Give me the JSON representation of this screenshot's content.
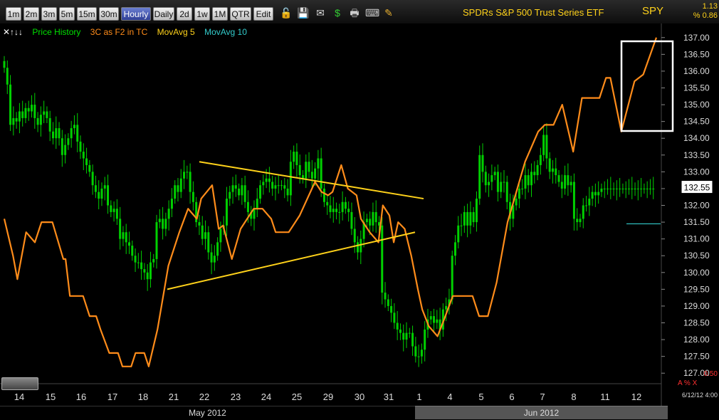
{
  "toolbar": {
    "timeframes": [
      "1m",
      "2m",
      "3m",
      "5m",
      "15m",
      "30m",
      "Hourly",
      "Daily",
      "2d",
      "1w",
      "1M",
      "QTR",
      "Edit"
    ],
    "active": "Hourly",
    "icons": [
      "lock-icon",
      "save-icon",
      "email-icon",
      "dollar-icon",
      "print-icon",
      "keyboard-icon",
      "pencil-icon"
    ]
  },
  "header": {
    "title": "SPDRs S&P 500 Trust Series ETF",
    "ticker": "SPY",
    "change": "1.13",
    "change_pct": "% 0.86"
  },
  "legend": {
    "controls": "✕↑↓↓",
    "items": [
      {
        "label": "Price History",
        "color": "#00e000"
      },
      {
        "label": "3C as F2 in TC",
        "color": "#ff8c1a"
      },
      {
        "label": "MovAvg 5",
        "color": "#ffd21a"
      },
      {
        "label": "MovAvg 10",
        "color": "#33cccc"
      }
    ]
  },
  "footer": {
    "date": "6/12/12 4:00",
    "bottom_value": "0.50",
    "alert_label": "A  %  X",
    "months": [
      {
        "label": "May 2012"
      },
      {
        "label": "Jun 2012"
      }
    ]
  },
  "chart_data": {
    "type": "line",
    "title": "SPDRs S&P 500 Trust Series ETF",
    "ylim": [
      126.75,
      137.25
    ],
    "yticks": [
      "137.00",
      "136.50",
      "136.00",
      "135.50",
      "135.00",
      "134.50",
      "134.00",
      "133.50",
      "133.00",
      "132.50",
      "132.00",
      "131.50",
      "131.00",
      "130.50",
      "130.00",
      "129.50",
      "129.00",
      "128.50",
      "128.00",
      "127.50",
      "127.00"
    ],
    "x_labels": [
      "14",
      "15",
      "16",
      "17",
      "18",
      "21",
      "22",
      "23",
      "24",
      "25",
      "29",
      "30",
      "31",
      "1",
      "4",
      "5",
      "6",
      "7",
      "8",
      "11",
      "12"
    ],
    "last_price": "132.55",
    "price_history": {
      "name": "Price History",
      "type": "candlestick",
      "bar_count": 215,
      "close": [
        136.1,
        135.6,
        134.4,
        134.6,
        134.5,
        134.8,
        134.6,
        134.9,
        134.8,
        135.0,
        134.6,
        134.4,
        134.7,
        134.8,
        134.6,
        134.2,
        134.0,
        134.3,
        134.0,
        133.5,
        133.8,
        134.0,
        134.3,
        134.4,
        133.9,
        133.6,
        133.4,
        133.2,
        133.0,
        132.6,
        132.4,
        132.2,
        132.5,
        132.6,
        132.0,
        131.8,
        131.9,
        131.6,
        131.0,
        131.2,
        130.9,
        130.8,
        130.5,
        130.3,
        130.3,
        130.1,
        130.0,
        129.8,
        130.3,
        130.4,
        131.5,
        131.6,
        131.3,
        131.6,
        131.9,
        132.2,
        132.6,
        132.4,
        132.8,
        133.0,
        133.0,
        132.4,
        132.1,
        131.5,
        131.4,
        131.0,
        131.2,
        130.6,
        130.3,
        130.5,
        130.9,
        131.3,
        131.4,
        132.2,
        132.4,
        132.6,
        132.5,
        132.3,
        132.6,
        132.1,
        131.8,
        131.6,
        131.9,
        132.2,
        132.6,
        132.7,
        132.8,
        132.7,
        132.5,
        132.6,
        132.6,
        132.6,
        132.5,
        132.3,
        133.3,
        133.6,
        133.2,
        132.9,
        132.8,
        133.3,
        133.0,
        132.8,
        133.1,
        133.4,
        132.5,
        132.1,
        132.0,
        131.8,
        131.9,
        131.8,
        131.8,
        132.1,
        131.9,
        131.8,
        131.3,
        130.9,
        130.6,
        131.0,
        131.5,
        131.6,
        131.4,
        131.8,
        131.5,
        131.4,
        129.4,
        129.2,
        129.0,
        128.8,
        128.5,
        128.3,
        128.2,
        128.0,
        128.2,
        128.2,
        127.8,
        127.5,
        127.5,
        127.7,
        128.3,
        128.6,
        128.7,
        128.5,
        128.6,
        128.3,
        128.9,
        129.0,
        129.2,
        130.5,
        130.9,
        131.4,
        131.4,
        131.8,
        131.4,
        131.8,
        131.5,
        132.2,
        133.5,
        133.0,
        132.6,
        132.7,
        132.9,
        133.0,
        132.4,
        132.7,
        132.7,
        132.1,
        131.6,
        132.0,
        132.2,
        132.5,
        132.5,
        132.9,
        132.6,
        133.0,
        132.9,
        133.2,
        133.5,
        134.1,
        133.4,
        133.0,
        133.1,
        132.9,
        132.7,
        132.5,
        132.9,
        132.6,
        132.7,
        131.6,
        131.5,
        131.6,
        132.0,
        132.0,
        132.2,
        132.4,
        132.3,
        132.4,
        132.5,
        132.5,
        132.5,
        132.5,
        132.5,
        132.5,
        132.5,
        132.5,
        132.5,
        132.5,
        132.5,
        132.5,
        132.5,
        132.5,
        132.5,
        132.5,
        132.5,
        132.5
      ]
    },
    "series": [
      {
        "name": "3C as F2 in TC",
        "color": "#ff8c1a",
        "points": [
          [
            0,
            131.6
          ],
          [
            4,
            130.5
          ],
          [
            6,
            129.8
          ],
          [
            10,
            131.2
          ],
          [
            14,
            130.9
          ],
          [
            17,
            131.5
          ],
          [
            22,
            131.5
          ],
          [
            27,
            130.4
          ],
          [
            28,
            130.4
          ],
          [
            30,
            129.3
          ],
          [
            36,
            129.3
          ],
          [
            39,
            128.7
          ],
          [
            42,
            128.7
          ],
          [
            44,
            128.3
          ],
          [
            48,
            127.6
          ],
          [
            52,
            127.6
          ],
          [
            54,
            127.2
          ],
          [
            58,
            127.2
          ],
          [
            60,
            127.6
          ],
          [
            64,
            127.6
          ],
          [
            66,
            127.2
          ],
          [
            70,
            128.3
          ],
          [
            75,
            130.2
          ],
          [
            80,
            131.2
          ],
          [
            84,
            131.9
          ],
          [
            88,
            131.6
          ],
          [
            90,
            132.2
          ],
          [
            95,
            132.6
          ],
          [
            98,
            131.3
          ],
          [
            100,
            131.4
          ],
          [
            104,
            130.4
          ],
          [
            108,
            131.3
          ],
          [
            114,
            131.9
          ],
          [
            118,
            131.9
          ],
          [
            122,
            131.6
          ],
          [
            124,
            131.2
          ],
          [
            130,
            131.2
          ],
          [
            135,
            131.7
          ],
          [
            142,
            132.7
          ],
          [
            145,
            132.4
          ],
          [
            148,
            132.3
          ],
          [
            150,
            132.4
          ],
          [
            154,
            133.2
          ],
          [
            157,
            132.5
          ],
          [
            161,
            132.3
          ],
          [
            163,
            131.6
          ],
          [
            167,
            131.2
          ],
          [
            171,
            130.9
          ],
          [
            173,
            132.0
          ],
          [
            176,
            131.7
          ],
          [
            178,
            130.9
          ],
          [
            180,
            131.5
          ],
          [
            183,
            131.3
          ],
          [
            186,
            130.5
          ],
          [
            189,
            129.5
          ],
          [
            191,
            128.9
          ],
          [
            194,
            128.4
          ],
          [
            198,
            128.1
          ],
          [
            201,
            128.6
          ],
          [
            205,
            129.3
          ],
          [
            209,
            129.3
          ],
          [
            214,
            129.3
          ],
          [
            217,
            128.7
          ],
          [
            221,
            128.7
          ],
          [
            225,
            129.7
          ],
          [
            230,
            131.5
          ],
          [
            238,
            133.3
          ],
          [
            244,
            134.2
          ],
          [
            247,
            134.4
          ],
          [
            251,
            134.4
          ],
          [
            255,
            135.0
          ],
          [
            260,
            133.6
          ],
          [
            264,
            135.2
          ],
          [
            268,
            135.2
          ],
          [
            272,
            135.2
          ],
          [
            275,
            135.8
          ],
          [
            277,
            135.8
          ],
          [
            282,
            134.2
          ],
          [
            288,
            135.7
          ],
          [
            292,
            135.9
          ],
          [
            298,
            137.0
          ]
        ]
      },
      {
        "name": "Upper trendline",
        "color": "#ffd21a",
        "points": [
          [
            0,
            133.3
          ],
          [
            1,
            132.2
          ]
        ]
      },
      {
        "name": "Lower trendline",
        "color": "#ffd21a",
        "points": [
          [
            0,
            129.5
          ],
          [
            1,
            131.2
          ]
        ]
      },
      {
        "name": "MovAvg 10",
        "color": "#33cccc",
        "points": [
          [
            0,
            131.45
          ],
          [
            1,
            131.45
          ]
        ]
      }
    ],
    "highlight_box": "top-right",
    "grid": false
  }
}
